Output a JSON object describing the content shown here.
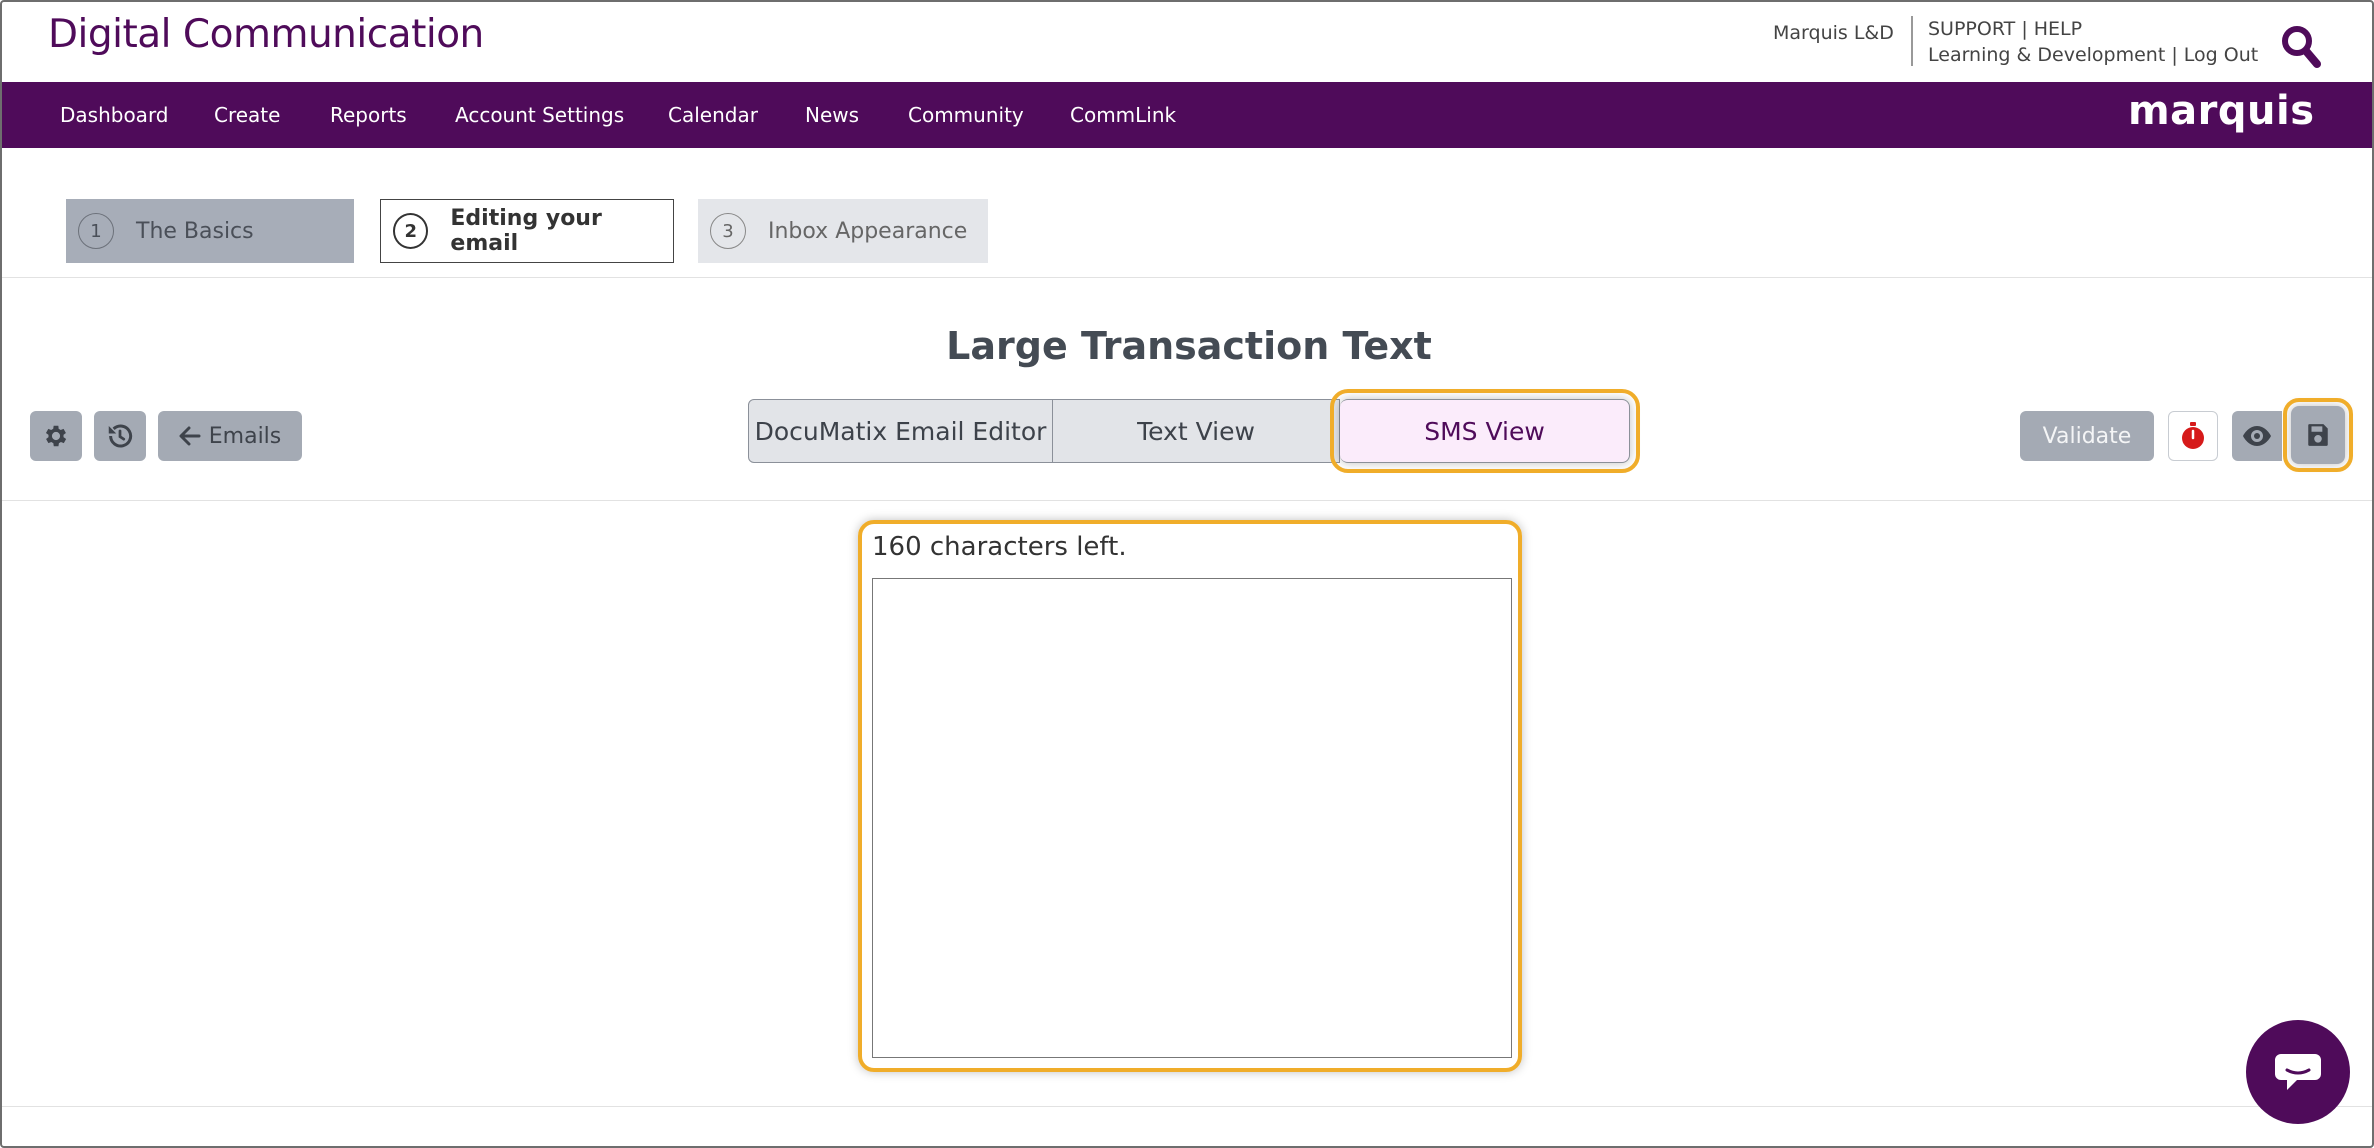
{
  "header": {
    "app_title": "Digital Communication",
    "user_name": "Marquis L&D",
    "support": "SUPPORT",
    "help": "HELP",
    "pipe": "|",
    "org_link": "Learning & Development",
    "logout": "Log Out",
    "search_icon": "search-icon"
  },
  "nav": {
    "items": [
      {
        "label": "Dashboard"
      },
      {
        "label": "Create"
      },
      {
        "label": "Reports"
      },
      {
        "label": "Account Settings"
      },
      {
        "label": "Calendar"
      },
      {
        "label": "News"
      },
      {
        "label": "Community"
      },
      {
        "label": "CommLink"
      }
    ],
    "logo": "marquis",
    "color": "#4f0b5a"
  },
  "steps": [
    {
      "number": "1",
      "label": "The Basics",
      "state": "completed"
    },
    {
      "number": "2",
      "label": "Editing your email",
      "state": "active"
    },
    {
      "number": "3",
      "label": "Inbox Appearance",
      "state": "upcoming"
    }
  ],
  "editor": {
    "title": "Large Transaction Text",
    "emails_button": "Emails",
    "settings_icon": "gear-icon",
    "history_icon": "history-icon",
    "back_icon": "arrow-left-icon",
    "view_tabs": [
      {
        "label": "DocuMatix Email Editor",
        "selected": false
      },
      {
        "label": "Text View",
        "selected": false
      },
      {
        "label": "SMS View",
        "selected": true
      }
    ],
    "validate_button": "Validate",
    "timer_icon": "stopwatch-icon",
    "preview_icon": "eye-icon",
    "save_icon": "floppy-disk-icon",
    "highlight_color": "#f0ad2a"
  },
  "sms": {
    "chars_left_text": "160 characters left.",
    "message_value": ""
  },
  "chat": {
    "icon": "chat-bubble-icon"
  }
}
